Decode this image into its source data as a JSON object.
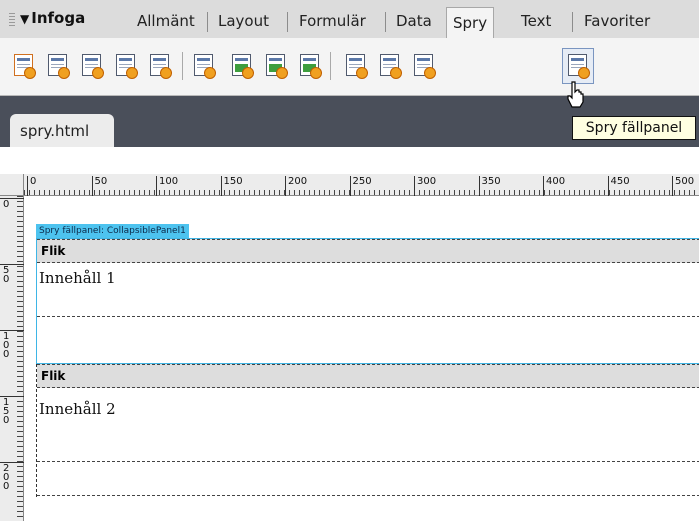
{
  "insert_panel": {
    "title": "Infoga",
    "tabs": [
      {
        "label": "Allmänt"
      },
      {
        "label": "Layout"
      },
      {
        "label": "Formulär"
      },
      {
        "label": "Data"
      },
      {
        "label": "Spry",
        "active": true
      },
      {
        "label": "Text"
      },
      {
        "label": "Favoriter"
      }
    ],
    "tools": [
      "spry-data-set-icon",
      "spry-region-icon",
      "spry-repeat-icon",
      "spry-repeat-list-icon",
      "spry-table-icon",
      "spry-validation-text-icon",
      "spry-validation-select-icon",
      "spry-validation-checkbox-icon",
      "spry-validation-textarea-icon",
      "spry-menu-bar-icon",
      "spry-tabbed-panels-icon",
      "spry-accordion-icon",
      "spry-collapsible-panel-icon"
    ],
    "tooltip": "Spry fällpanel"
  },
  "document": {
    "tab_label": "spry.html"
  },
  "design_view": {
    "ruler_h": [
      "0",
      "50",
      "100",
      "150",
      "200",
      "250",
      "300",
      "350",
      "400",
      "450",
      "500"
    ],
    "ruler_v": [
      "0",
      "50",
      "100",
      "150",
      "200"
    ],
    "panel_label": "Spry fällpanel: CollapsiblePanel1",
    "panels": [
      {
        "tab": "Flik",
        "content": "Innehåll 1"
      },
      {
        "tab": "Flik",
        "content": "Innehåll 2"
      }
    ]
  },
  "colors": {
    "selection_border": "#3eb5e6",
    "panel_label_bg": "#4dc3ef",
    "tab_strip_bg": "#dddddd",
    "tooltip_bg": "#ffffe1"
  }
}
